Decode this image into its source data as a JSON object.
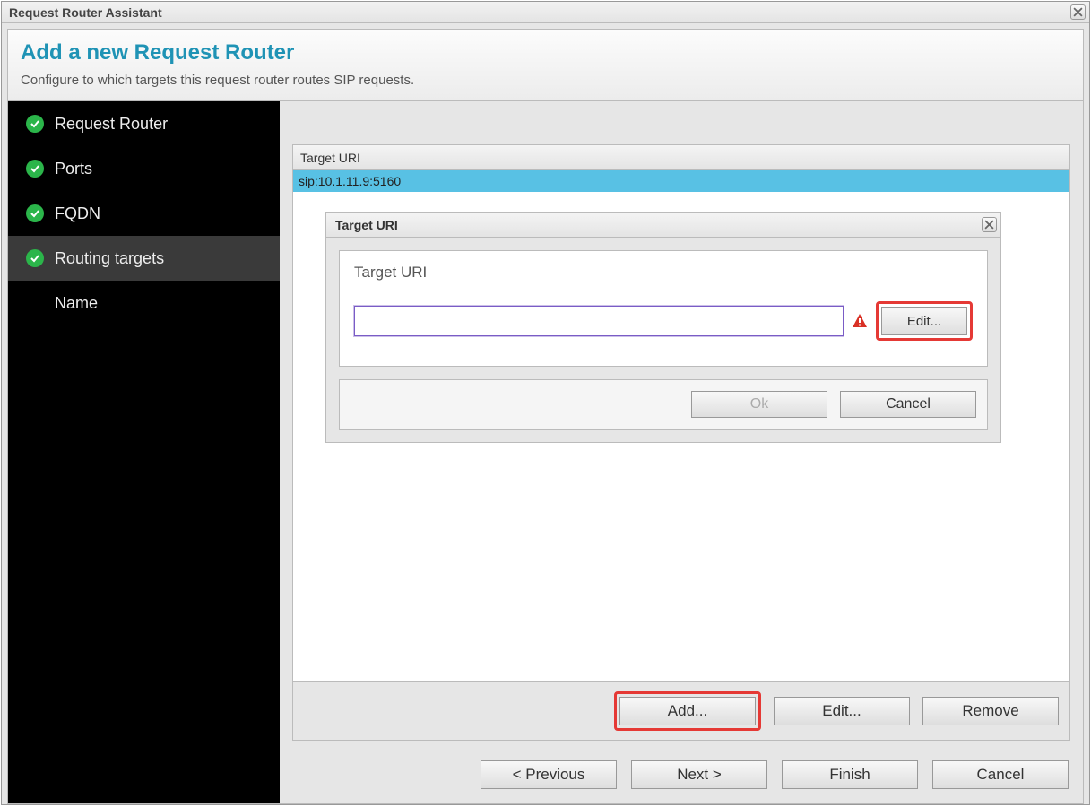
{
  "window": {
    "title": "Request Router Assistant"
  },
  "header": {
    "title": "Add a new Request Router",
    "subtitle": "Configure to which targets this request router routes SIP requests."
  },
  "sidebar": {
    "items": [
      {
        "label": "Request Router",
        "done": true,
        "active": false
      },
      {
        "label": "Ports",
        "done": true,
        "active": false
      },
      {
        "label": "FQDN",
        "done": true,
        "active": false
      },
      {
        "label": "Routing targets",
        "done": true,
        "active": true
      },
      {
        "label": "Name",
        "done": false,
        "active": false
      }
    ]
  },
  "targets": {
    "column_header": "Target URI",
    "rows": [
      "sip:10.1.11.9:5160"
    ],
    "buttons": {
      "add": "Add...",
      "edit": "Edit...",
      "remove": "Remove"
    }
  },
  "dialog": {
    "title": "Target URI",
    "field_label": "Target URI",
    "value": "",
    "edit": "Edit...",
    "ok": "Ok",
    "cancel": "Cancel"
  },
  "wizard": {
    "prev": "< Previous",
    "next": "Next >",
    "finish": "Finish",
    "cancel": "Cancel"
  }
}
